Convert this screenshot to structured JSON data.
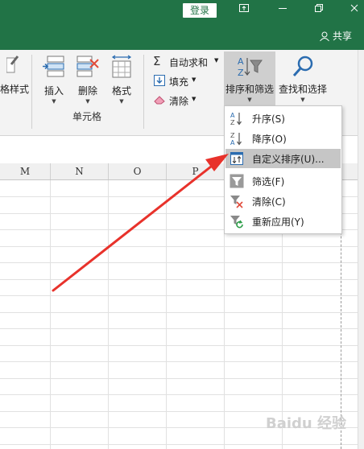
{
  "titlebar": {
    "login_label": "登录",
    "share_label": "共享",
    "icons": [
      "restore-window-icon",
      "minimize-icon",
      "window-icon",
      "close-icon",
      "user-icon"
    ]
  },
  "ribbon": {
    "partial_label": "格样式",
    "insert_label": "插入",
    "delete_label": "删除",
    "format_label": "格式",
    "cells_group_label": "单元格",
    "autosum_label": "自动求和",
    "fill_label": "填充",
    "clear_label": "清除",
    "sort_filter_label": "排序和筛选",
    "find_select_label": "查找和选择"
  },
  "column_headers": [
    "M",
    "N",
    "O",
    "P"
  ],
  "sort_menu": {
    "items": [
      {
        "label": "升序(S)",
        "icon": "sort-ascending-icon",
        "enabled": true,
        "highlighted": false
      },
      {
        "label": "降序(O)",
        "icon": "sort-descending-icon",
        "enabled": true,
        "highlighted": false
      },
      {
        "label": "自定义排序(U)...",
        "icon": "custom-sort-icon",
        "enabled": true,
        "highlighted": true
      },
      {
        "label": "筛选(F)",
        "icon": "filter-icon",
        "enabled": true,
        "highlighted": false
      },
      {
        "label": "清除(C)",
        "icon": "clear-filter-icon",
        "enabled": true,
        "highlighted": false
      },
      {
        "label": "重新应用(Y)",
        "icon": "reapply-icon",
        "enabled": true,
        "highlighted": false
      }
    ]
  },
  "annotation": {
    "type": "red-arrow",
    "points_to": "自定义排序(U)..."
  },
  "watermark_text": "Baidu 经验",
  "colors": {
    "excel_green": "#217346",
    "arrow": "#e8322b",
    "highlight": "#c6c6c6"
  }
}
